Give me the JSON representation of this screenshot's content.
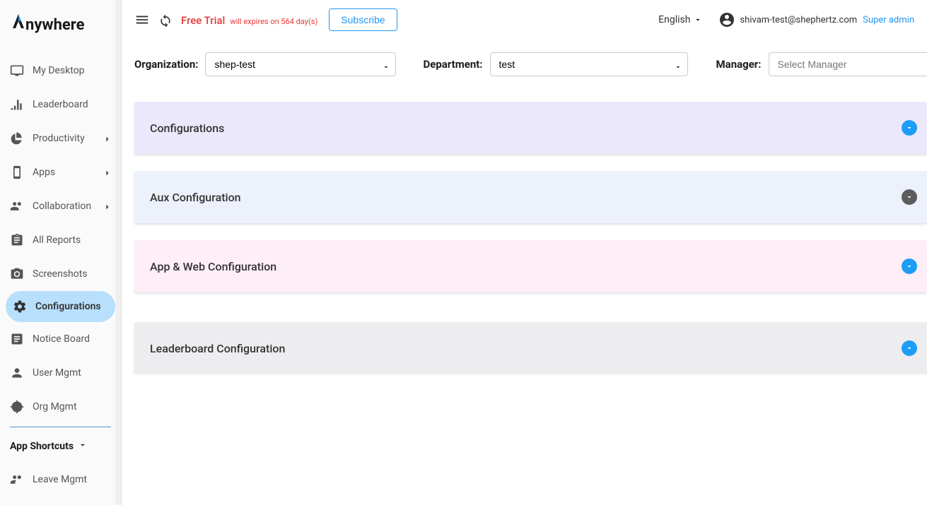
{
  "logo": {
    "text": "nywhere"
  },
  "sidebar": {
    "items": [
      {
        "label": "My Desktop"
      },
      {
        "label": "Leaderboard"
      },
      {
        "label": "Productivity"
      },
      {
        "label": "Apps"
      },
      {
        "label": "Collaboration"
      },
      {
        "label": "All Reports"
      },
      {
        "label": "Screenshots"
      },
      {
        "label": "Configurations"
      },
      {
        "label": "Notice Board"
      },
      {
        "label": "User Mgmt"
      },
      {
        "label": "Org Mgmt"
      }
    ],
    "shortcuts_header": "App Shortcuts",
    "shortcut_items": [
      {
        "label": "Leave Mgmt"
      }
    ]
  },
  "topbar": {
    "trial_label": "Free Trial",
    "trial_sub": "will expires on 564 day(s)",
    "subscribe_label": "Subscribe",
    "language": "English",
    "user_email": "shivam-test@shephertz.com",
    "user_role": "Super admin"
  },
  "filters": {
    "org_label": "Organization:",
    "org_value": "shep-test",
    "dept_label": "Department:",
    "dept_value": "test",
    "mgr_label": "Manager:",
    "mgr_placeholder": "Select Manager"
  },
  "panels": [
    {
      "title": "Configurations",
      "toggle_color": "blue"
    },
    {
      "title": "Aux Configuration",
      "toggle_color": "dark"
    },
    {
      "title": "App & Web Configuration",
      "toggle_color": "blue"
    },
    {
      "title": "Leaderboard Configuration",
      "toggle_color": "blue"
    }
  ]
}
